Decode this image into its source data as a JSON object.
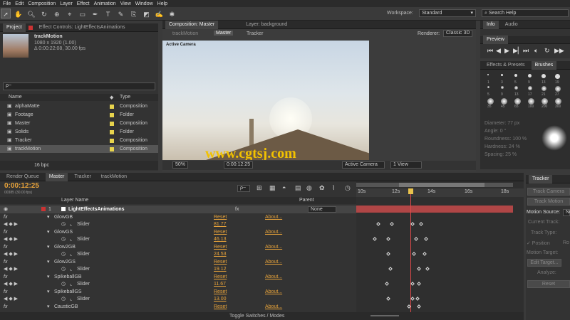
{
  "menu": [
    "File",
    "Edit",
    "Composition",
    "Layer",
    "Effect",
    "Animation",
    "View",
    "Window",
    "Help"
  ],
  "toolbar": {
    "workspace_label": "Workspace:",
    "workspace_value": "Standard",
    "search_placeholder": "Search Help"
  },
  "project": {
    "tabs": [
      "Project",
      "Effect Controls: LightEffectsAnimations"
    ],
    "item_name": "trackMotion",
    "item_size": "1080 x 1920 (1.00)",
    "item_time": "Δ 0:00:22:08, 30.00 fps",
    "search": "ρ~",
    "col_name": "Name",
    "col_type": "Type",
    "items": [
      {
        "name": "alphaMatte",
        "type": "Composition",
        "color": "#e8d44d"
      },
      {
        "name": "Footage",
        "type": "Folder",
        "color": "#e8d44d"
      },
      {
        "name": "Master",
        "type": "Composition",
        "color": "#e8d44d"
      },
      {
        "name": "Solids",
        "type": "Folder",
        "color": "#e8d44d"
      },
      {
        "name": "Tracker",
        "type": "Composition",
        "color": "#e8d44d"
      },
      {
        "name": "trackMotion",
        "type": "Composition",
        "color": "#e8d44d"
      }
    ],
    "bpc": "16 bpc"
  },
  "comp": {
    "tab": "Composition: Master",
    "layer_tab": "Layer: background",
    "flow": [
      "trackMotion",
      "Master",
      "Tracker"
    ],
    "renderer_label": "Renderer:",
    "renderer_value": "Classic 3D",
    "camera_label": "Active Camera",
    "zoom": "50%",
    "timecode": "0:00:12:25",
    "camera": "Active Camera",
    "views": "1 View",
    "watermark": "www.cgtsj.com"
  },
  "right": {
    "info_tabs": [
      "Info",
      "Audio"
    ],
    "preview": "Preview",
    "fx_tabs": [
      "Effects & Presets",
      "Brushes"
    ],
    "brush_nums": [
      "1",
      "3",
      "5",
      "9",
      "13",
      "19",
      "5",
      "9",
      "13",
      "17",
      "21",
      "27",
      "35",
      "45",
      "65",
      "100",
      "200",
      "300"
    ],
    "brush_props": [
      "Diameter: 77 px",
      "Angle: 0 °",
      "Roundness: 100 %",
      "Hardness: 24 %",
      "Spacing: 25 %"
    ]
  },
  "timeline": {
    "tabs": [
      "Render Queue",
      "Master",
      "Tracker",
      "trackMotion"
    ],
    "time": "0:00:12:25",
    "time_sub": "00385 (30.00 fps)",
    "search": "ρ~",
    "col_layer": "Layer Name",
    "col_parent": "Parent",
    "ruler": [
      "10s",
      "12s",
      "14s",
      "16s",
      "18s"
    ],
    "layer_num": "1",
    "layer_name": "LightEffectsAnimations",
    "parent_value": "None",
    "rows": [
      {
        "name": "GlowGB",
        "slider": "Slider",
        "value": "81.77"
      },
      {
        "name": "GlowGS",
        "slider": "Slider",
        "value": "46.13"
      },
      {
        "name": "Glow2GB",
        "slider": "Slider",
        "value": "24.53"
      },
      {
        "name": "Glow2GS",
        "slider": "Slider",
        "value": "19.12"
      },
      {
        "name": "SpikeballGB",
        "slider": "Slider",
        "value": "11.67"
      },
      {
        "name": "SpikeballGS",
        "slider": "Slider",
        "value": "13.00"
      },
      {
        "name": "CausticGB",
        "slider": "Slider",
        "value": ""
      }
    ],
    "reset": "Reset",
    "about": "About...",
    "fx": "fx",
    "toggle": "Toggle Switches / Modes"
  },
  "tracker": {
    "title": "Tracker",
    "track_camera": "Track Camera",
    "track_motion": "Track Motion",
    "motion_source": "Motion Source:",
    "motion_source_value": "No",
    "current_track": "Current Track:",
    "track_type": "Track Type:",
    "position": "✓ Position",
    "rotation": "Ro",
    "motion_target": "Motion Target:",
    "edit_target": "Edit Target...",
    "analyze": "Analyze:",
    "reset": "Reset"
  }
}
